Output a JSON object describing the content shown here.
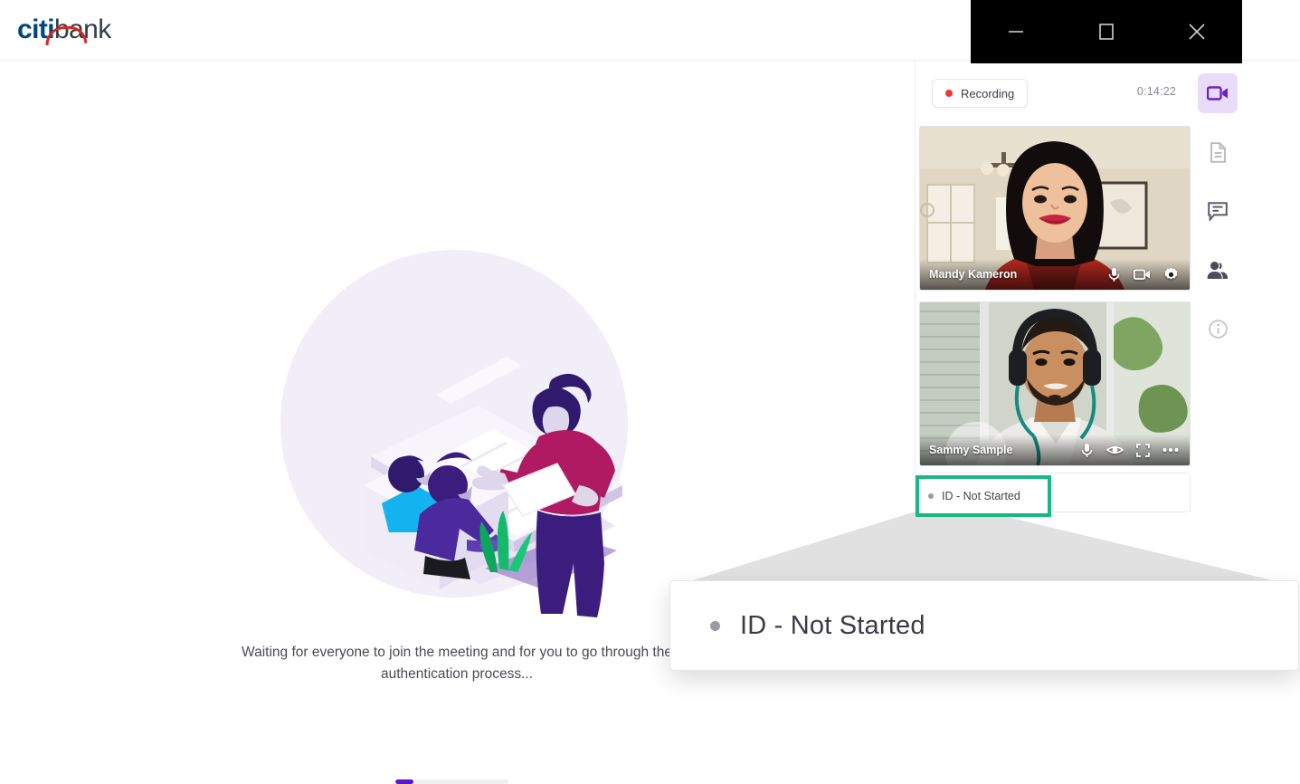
{
  "brand": {
    "name_primary": "citi",
    "name_secondary": "bank",
    "logo_arc_color": "#d9261c",
    "primary_color": "#004481"
  },
  "window_controls": {
    "minimize_label": "Minimize",
    "maximize_label": "Maximize",
    "close_label": "Close",
    "bar_color": "#000000"
  },
  "stage": {
    "waiting_message": "Waiting for everyone to join the meeting and for you to go through the authentication process...",
    "progress_percent": 16,
    "progress_color": "#5a17c9",
    "illustration_name": "meeting-presentation-illustration"
  },
  "meeting_panel": {
    "recording": {
      "label": "Recording",
      "dot_color": "#f0362e"
    },
    "timer": "0:14:22",
    "tiles": [
      {
        "name": "Mandy Kameron",
        "controls": [
          "microphone-icon",
          "camera-icon",
          "settings-gear-icon"
        ]
      },
      {
        "name": "Sammy Sample",
        "controls": [
          "microphone-icon",
          "eye-icon",
          "fullscreen-icon",
          "more-options-icon"
        ]
      }
    ],
    "status": {
      "text": "ID - Not Started",
      "dot_color": "#9a9aa2",
      "highlight_color": "#17b981"
    }
  },
  "callout": {
    "text": "ID - Not Started",
    "dot_color": "#9a9aa2"
  },
  "rail": {
    "items": [
      {
        "icon": "video-camera-icon",
        "active": true
      },
      {
        "icon": "document-icon",
        "active": false
      },
      {
        "icon": "chat-icon",
        "active": false
      },
      {
        "icon": "people-icon",
        "active": false
      },
      {
        "icon": "info-icon",
        "active": false
      }
    ],
    "active_color": "#6b21c8",
    "active_bg": "#e9dcfb"
  }
}
